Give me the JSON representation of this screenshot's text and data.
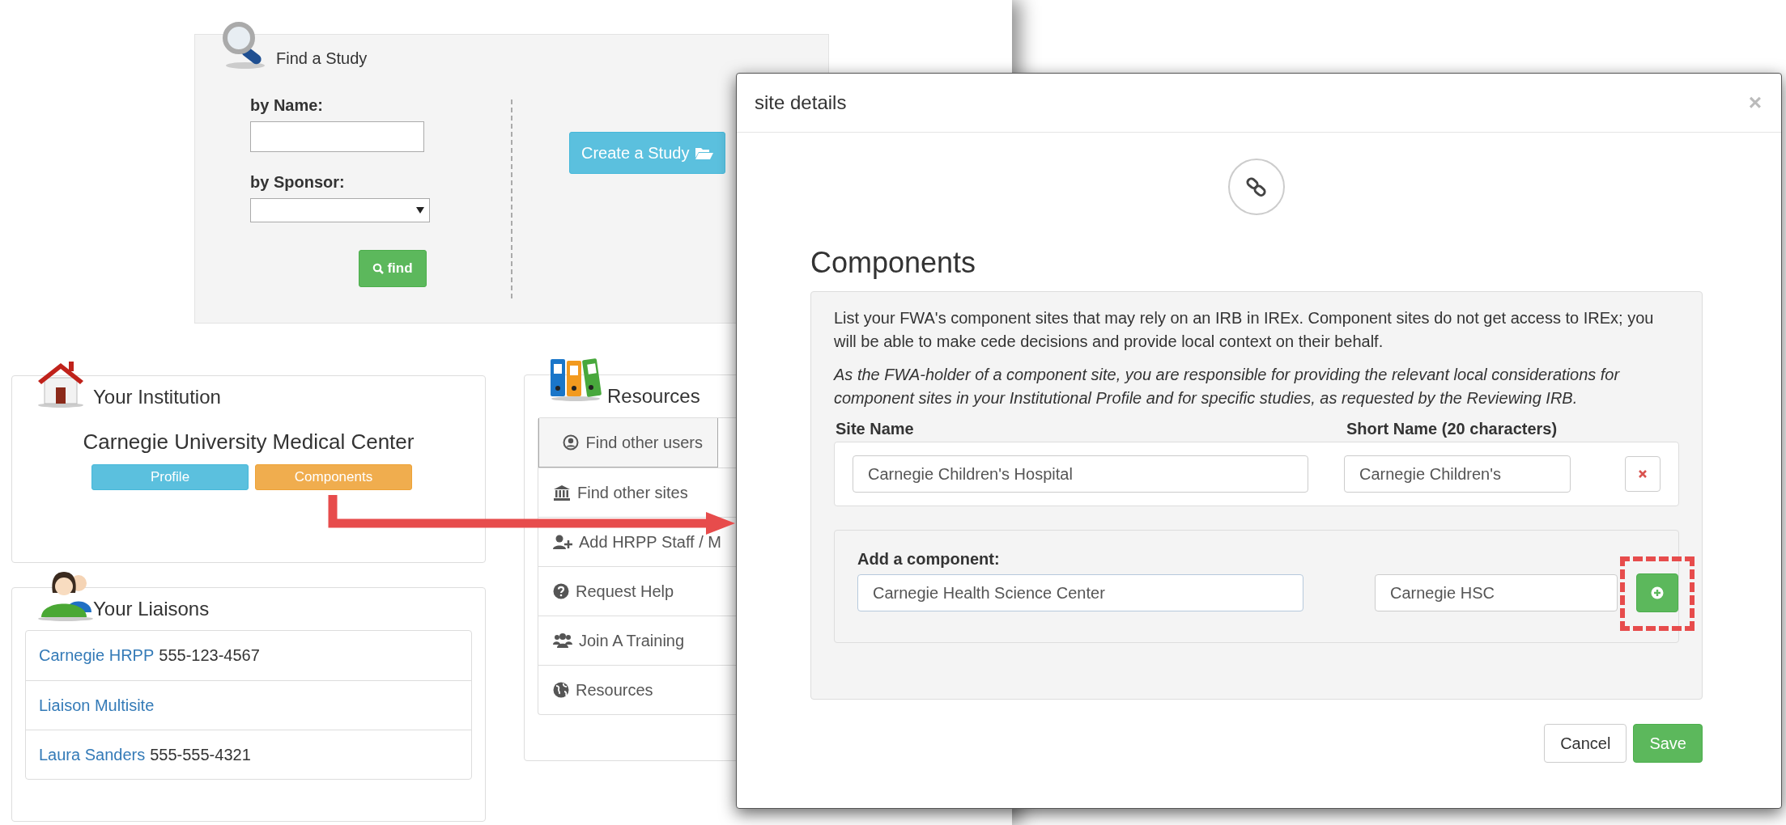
{
  "find_study": {
    "title": "Find a Study",
    "name_label": "by Name:",
    "sponsor_label": "by Sponsor:",
    "find_button": "find",
    "create_button": "Create a Study"
  },
  "institution": {
    "title": "Your Institution",
    "name": "Carnegie University Medical Center",
    "buttons": [
      {
        "label": "Profile",
        "kind": "info"
      },
      {
        "label": "Components",
        "kind": "warning"
      }
    ]
  },
  "liaisons": {
    "title": "Your Liaisons",
    "items": [
      {
        "name": "Carnegie HRPP",
        "phone": "555-123-4567"
      },
      {
        "name": "Liaison Multisite"
      },
      {
        "name": "Laura Sanders",
        "phone": "555-555-4321"
      }
    ]
  },
  "resources": {
    "title": "Resources",
    "items": [
      {
        "label": "Find other users",
        "selected": true
      },
      {
        "label": "Find other sites",
        "selected": false
      },
      {
        "label": "Add HRPP Staff / M",
        "selected": false
      },
      {
        "label": "Request Help",
        "selected": false
      },
      {
        "label": "Join A Training",
        "selected": false
      },
      {
        "label": "Resources",
        "selected": false
      }
    ]
  },
  "modal": {
    "title": "site details",
    "close": "×",
    "heading": "Components",
    "intro": "List your FWA's component sites that may rely on an IRB in IREx. Component sites do not get access to IREx; you will be able to make cede decisions and provide local context on their behalf.",
    "note": "As the FWA-holder of a component site, you are responsible for providing the relevant local considerations for component sites in your Institutional Profile and for specific studies, as requested by the Reviewing IRB.",
    "columns": [
      "Site Name",
      "Short Name (20 characters)"
    ],
    "sites": [
      {
        "name": "Carnegie Children's Hospital",
        "short_name": "Carnegie Children's"
      }
    ],
    "add": {
      "label": "Add a component:",
      "name": "Carnegie Health Science Center",
      "short_name": "Carnegie HSC"
    },
    "buttons": [
      {
        "label": "Cancel",
        "kind": "default"
      },
      {
        "label": "Save",
        "kind": "success"
      }
    ]
  }
}
